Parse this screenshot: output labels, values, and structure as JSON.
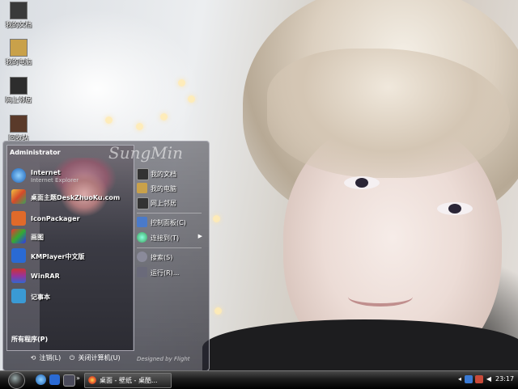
{
  "desktop": {
    "icons": [
      {
        "label": "我的文档",
        "color": "#3a3a3a"
      },
      {
        "label": "我的电脑",
        "color": "#c9a14a"
      },
      {
        "label": "网上邻居",
        "color": "#2d2d2d"
      },
      {
        "label": "回收站",
        "color": "#5a3a2a"
      }
    ]
  },
  "start_menu": {
    "user": "Administrator",
    "signature": "SungMin",
    "pinned": [
      {
        "title": "Internet",
        "subtitle": "Internet Explorer",
        "icon": "ie-icon",
        "color": "#3a8ad9"
      },
      {
        "title": "桌面主题DeskZhuoKu.com",
        "subtitle": "",
        "icon": "theme-icon",
        "color": "#d44a2a"
      }
    ],
    "programs": [
      {
        "title": "IconPackager",
        "icon": "iconpackager-icon",
        "color": "#e06a2a"
      },
      {
        "title": "画图",
        "icon": "paint-icon",
        "color": "#4a8a3a"
      },
      {
        "title": "KMPlayer中文版",
        "icon": "kmplayer-icon",
        "color": "#2a6ad4"
      },
      {
        "title": "WinRAR",
        "icon": "winrar-icon",
        "color": "#9a3a8a"
      },
      {
        "title": "记事本",
        "icon": "notepad-icon",
        "color": "#3a9ad4"
      }
    ],
    "all_programs": "所有程序(P)",
    "right_items": [
      {
        "label": "我的文档",
        "icon": "documents-icon",
        "color": "#333"
      },
      {
        "label": "我的电脑",
        "icon": "computer-icon",
        "color": "#c9a14a"
      },
      {
        "label": "网上邻居",
        "icon": "network-icon",
        "color": "#333"
      },
      {
        "label": "控制面板(C)",
        "icon": "control-panel-icon",
        "color": "#4a7ac9"
      },
      {
        "label": "连接到(T)",
        "icon": "connect-icon",
        "color": "#3aa05a"
      },
      {
        "label": "搜索(S)",
        "icon": "search-icon",
        "color": "#8a8a9a"
      },
      {
        "label": "运行(R)...",
        "icon": "run-icon",
        "color": "#6a6a7a"
      }
    ],
    "logoff": "注销(L)",
    "shutdown": "关闭计算机(U)",
    "designer": "Designed by Flight"
  },
  "taskbar": {
    "task_label": "桌面 - 壁纸 - 桌酷...",
    "clock": "23:17"
  }
}
